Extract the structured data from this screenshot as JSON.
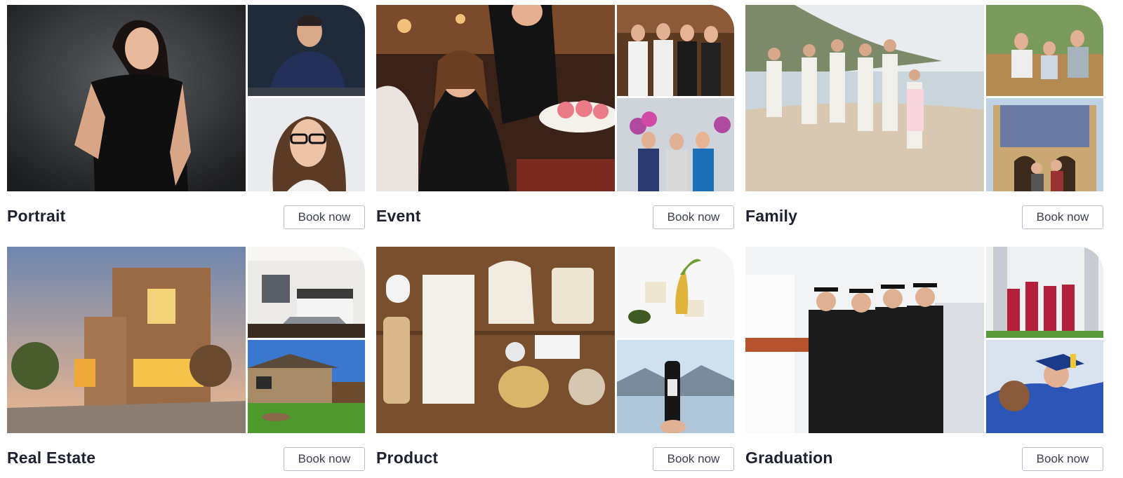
{
  "services": [
    {
      "title": "Portrait",
      "button": "Book now"
    },
    {
      "title": "Event",
      "button": "Book now"
    },
    {
      "title": "Family",
      "button": "Book now"
    },
    {
      "title": "Real Estate",
      "button": "Book now"
    },
    {
      "title": "Product",
      "button": "Book now"
    },
    {
      "title": "Graduation",
      "button": "Book now"
    }
  ],
  "colors": {
    "title": "#1e2230",
    "button_border": "#b7bcc6",
    "button_text": "#3a3f4a"
  }
}
